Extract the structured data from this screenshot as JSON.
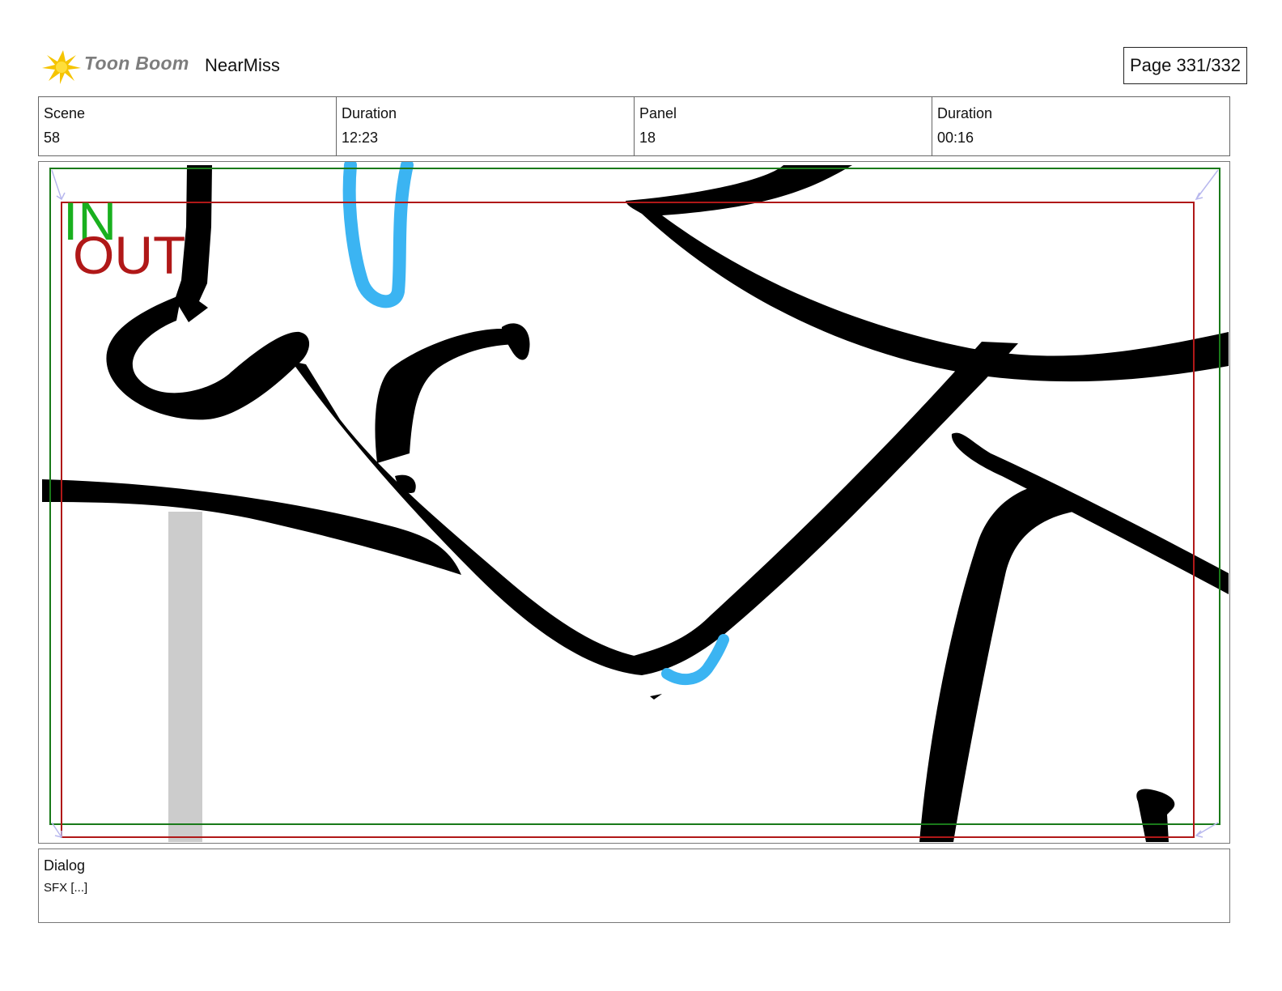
{
  "header": {
    "brand": "Toon Boom",
    "project": "NearMiss",
    "page": "Page 331/332"
  },
  "info": {
    "scene_label": "Scene",
    "scene_value": "58",
    "scene_duration_label": "Duration",
    "scene_duration_value": "12:23",
    "panel_label": "Panel",
    "panel_value": "18",
    "panel_duration_label": "Duration",
    "panel_duration_value": "00:16"
  },
  "panel": {
    "in_label": "IN",
    "out_label": "OUT",
    "colors": {
      "in_frame": "#1a7a1a",
      "out_frame": "#b01818",
      "ink": "#000000",
      "accent_blue": "#3bb4f2",
      "gray_stroke": "#cccccc"
    }
  },
  "dialog": {
    "label": "Dialog",
    "text": "SFX [...]"
  }
}
